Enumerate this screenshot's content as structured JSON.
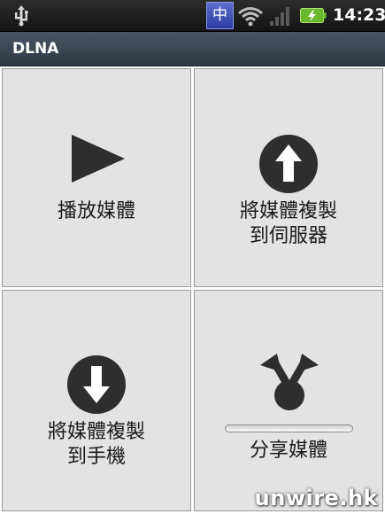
{
  "status_bar": {
    "ime_indicator": "中",
    "time": "14:23",
    "icons": [
      "usb-icon",
      "input-method-icon",
      "wifi-icon",
      "signal-icon",
      "battery-charging-icon"
    ],
    "colors": {
      "battery": "#6ab82d",
      "background": "#1f1f1f"
    }
  },
  "title_bar": {
    "title": "DLNA"
  },
  "tiles": [
    {
      "label": "播放媒體",
      "icon": "play-icon"
    },
    {
      "label_line1": "將媒體複製",
      "label_line2": "到伺服器",
      "icon": "upload-arrow-icon"
    },
    {
      "label_line1": "將媒體複製",
      "label_line2": "到手機",
      "icon": "download-arrow-icon"
    },
    {
      "label": "分享媒體",
      "icon": "share-icon"
    }
  ],
  "watermark": "unwire.hk",
  "colors": {
    "tile_bg": "#e3e3e3",
    "icon": "#2e2e2e",
    "title_bar": "#3d4656"
  }
}
